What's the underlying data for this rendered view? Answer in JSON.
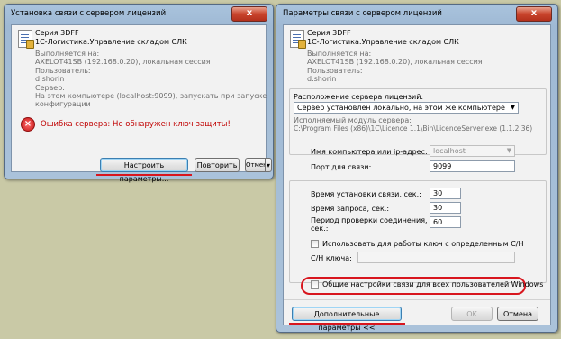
{
  "left": {
    "title": "Установка связи с сервером лицензий",
    "close": "x",
    "product": "Серия 3DFF",
    "config": "1С-Логистика:Управление складом СЛК",
    "run_label": "Выполняется на:",
    "run_value": "AXELOT41SB (192.168.0.20), локальная сессия",
    "user_label": "Пользователь:",
    "user_value": "d.shorin",
    "server_label": "Сервер:",
    "server_value_1": "На этом компьютере (localhost:9099), запускать при запуске",
    "server_value_2": "конфигурации",
    "error": "Ошибка сервера: Не обнаружен ключ защиты!",
    "btn_settings": "Настроить параметры...",
    "btn_retry": "Повторить",
    "btn_cancel": "Отмена",
    "btn_menu_arrow": "▾"
  },
  "right": {
    "title": "Параметры связи с сервером лицензий",
    "close": "x",
    "product": "Серия 3DFF",
    "config": "1С-Логистика:Управление складом СЛК",
    "run_label": "Выполняется на:",
    "run_value": "AXELOT41SB (192.168.0.20), локальная сессия",
    "user_label": "Пользователь:",
    "user_value": "d.shorin",
    "location_label": "Расположение сервера лицензий:",
    "location_value": "Сервер установлен локально, на этом же компьютере",
    "module_label": "Исполняемый модуль сервера:",
    "module_value": "C:\\Program Files (x86)\\1C\\Licence 1.1\\Bin\\LicenceServer.exe (1.1.2.36)",
    "host_label": "Имя компьютера или ip-адрес:",
    "host_value": "localhost",
    "port_label": "Порт для связи:",
    "port_value": "9099",
    "conn_time_label": "Время установки связи, сек.:",
    "conn_time_value": "30",
    "req_time_label": "Время запроса, сек.:",
    "req_time_value": "30",
    "check_period_label_1": "Период проверки соединения,",
    "check_period_label_2": "сек.:",
    "check_period_value": "60",
    "use_key_label": "Использовать для работы ключ с определенным С/Н",
    "sn_label": "С/Н ключа:",
    "sn_value": "",
    "common_settings_label": "Общие настройки связи для всех пользователей Windows",
    "btn_advanced": "Дополнительные параметры <<",
    "btn_ok": "OK",
    "btn_cancel": "Отмена"
  },
  "colors": {
    "highlight": "#d8161e",
    "error_text": "#c00000",
    "window_frame": "#a9c3dd"
  }
}
